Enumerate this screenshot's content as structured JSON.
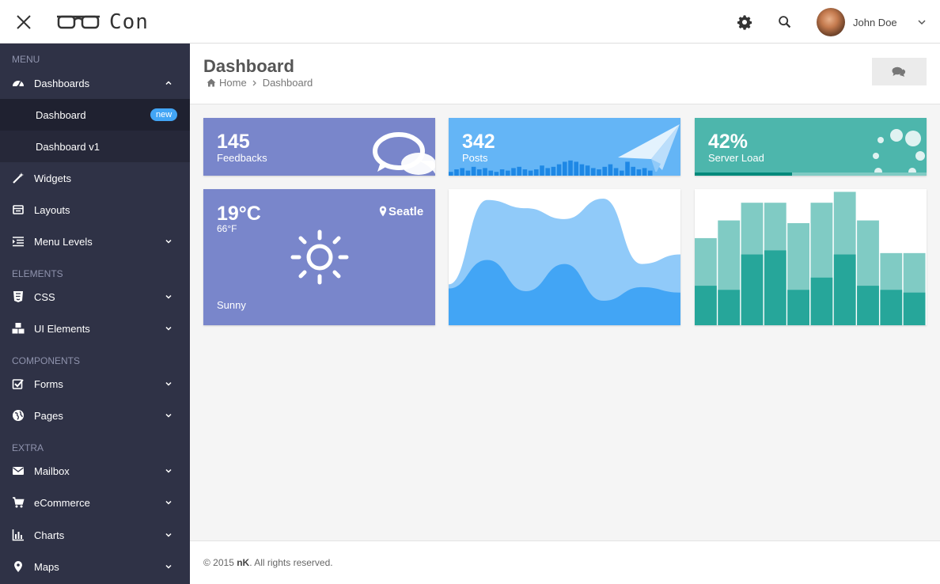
{
  "header": {
    "logo_text": "Con",
    "user_name": "John Doe"
  },
  "sidebar": {
    "sections": {
      "menu": "MENU",
      "elements": "ELEMENTS",
      "components": "COMPONENTS",
      "extra": "EXTRA"
    },
    "items": {
      "dashboards": "Dashboards",
      "widgets": "Widgets",
      "layouts": "Layouts",
      "menu_levels": "Menu Levels",
      "css": "CSS",
      "ui_elements": "UI Elements",
      "forms": "Forms",
      "pages": "Pages",
      "mailbox": "Mailbox",
      "ecommerce": "eCommerce",
      "charts": "Charts",
      "maps": "Maps"
    },
    "sub_items": {
      "dashboard": "Dashboard",
      "dashboard_badge": "new",
      "dashboard_v1": "Dashboard v1"
    }
  },
  "page": {
    "title": "Dashboard",
    "breadcrumb_home": "Home",
    "breadcrumb_current": "Dashboard"
  },
  "stats": {
    "feedbacks": {
      "value": "145",
      "label": "Feedbacks"
    },
    "posts": {
      "value": "342",
      "label": "Posts",
      "bars": [
        3,
        5,
        6,
        4,
        7,
        5,
        6,
        4,
        3,
        5,
        4,
        6,
        7,
        5,
        4,
        5,
        8,
        6,
        7,
        9,
        11,
        12,
        11,
        9,
        8,
        6,
        5,
        7,
        9,
        6,
        4,
        11,
        7,
        5,
        6,
        4
      ]
    },
    "server_load": {
      "value": "42%",
      "label": "Server Load",
      "progress": 0.42
    }
  },
  "weather": {
    "temp_c": "19°C",
    "temp_f": "66°F",
    "city": "Seatle",
    "condition": "Sunny"
  },
  "area_chart": {
    "back_series": [
      0.3,
      0.92,
      0.86,
      0.78,
      0.93,
      0.45,
      0.52
    ],
    "front_series": [
      0.27,
      0.48,
      0.25,
      0.45,
      0.18,
      0.28,
      0.24
    ]
  },
  "bar_chart": {
    "light": [
      0.64,
      0.77,
      0.9,
      0.9,
      0.75,
      0.9,
      0.98,
      0.77,
      0.53,
      0.53
    ],
    "dark": [
      0.29,
      0.26,
      0.52,
      0.55,
      0.26,
      0.35,
      0.52,
      0.29,
      0.26,
      0.24
    ]
  },
  "footer": {
    "year": "© 2015",
    "brand": "nK",
    "rights": ". All rights reserved."
  },
  "colors": {
    "sidebar_bg": "#2f3246",
    "feedback_card": "#7986cb",
    "posts_card": "#64b5f6",
    "server_card": "#4db6ac",
    "badge_new": "#42a5f5"
  }
}
